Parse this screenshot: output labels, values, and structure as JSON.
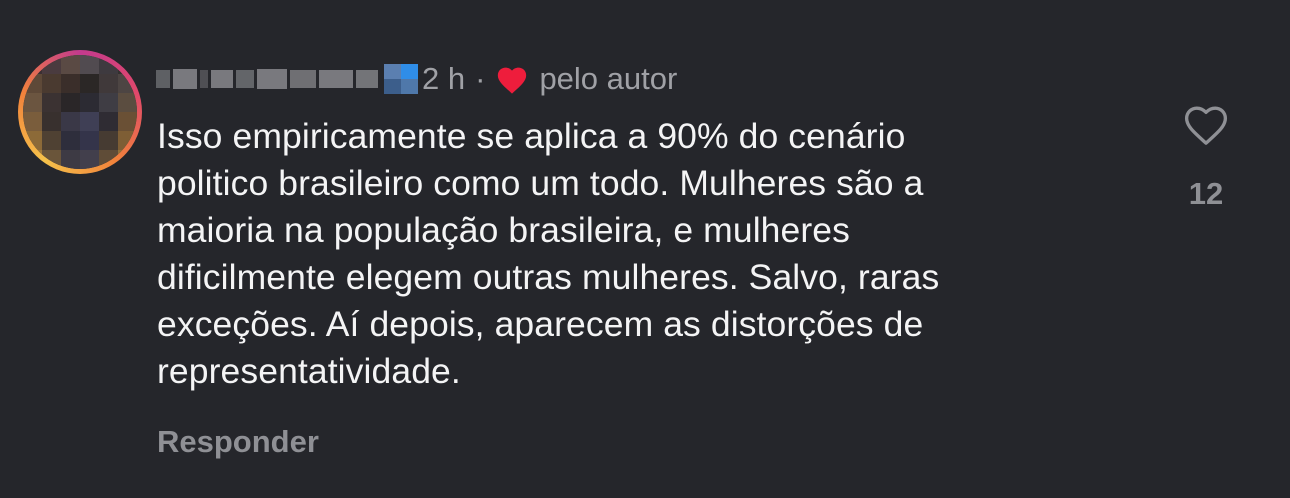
{
  "comment": {
    "time": "2 h",
    "separator": "·",
    "liked_by_author_label": "pelo autor",
    "body_lines": [
      "Isso empiricamente se aplica a 90% do cenário",
      "politico brasileiro como um todo. Mulheres são a",
      "maioria na população brasileira, e mulheres",
      "dificilmente elegem outras mulheres. Salvo, raras",
      "exceções. Aí depois, aparecem as distorções de",
      "representatividade."
    ],
    "reply_label": "Responder",
    "like_count": "12"
  },
  "icons": {
    "author_heart": "heart-filled-icon",
    "like": "heart-outline-icon"
  },
  "colors": {
    "background": "#25262b",
    "author_heart": "#ee1d3c",
    "muted_text": "#8f9095"
  }
}
